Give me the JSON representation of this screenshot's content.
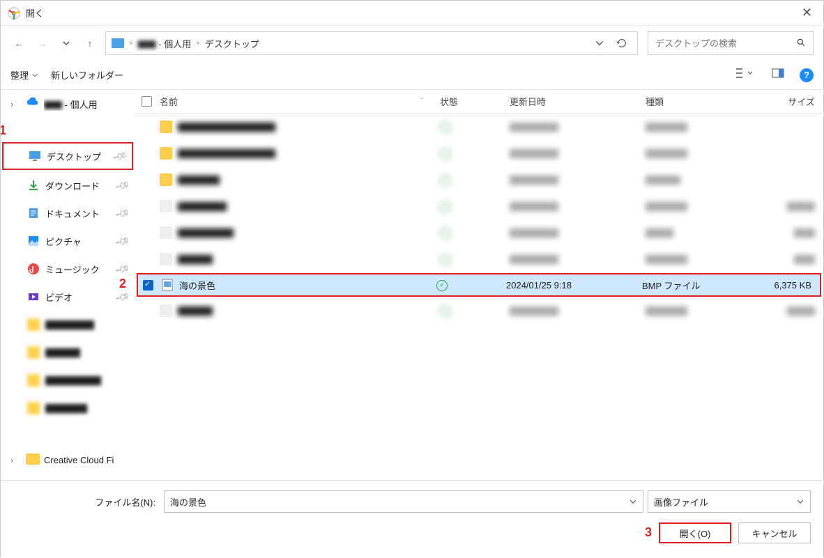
{
  "window": {
    "title": "開く"
  },
  "breadcrumbs": {
    "user_suffix": " - 個人用",
    "leaf": "デスクトップ"
  },
  "search": {
    "placeholder": "デスクトップの検索"
  },
  "toolbar": {
    "organize": "整理",
    "new_folder": "新しいフォルダー"
  },
  "columns": {
    "name": "名前",
    "state": "状態",
    "date": "更新日時",
    "type": "種類",
    "size": "サイズ"
  },
  "sidebar": {
    "onedrive_suffix": " - 個人用",
    "items": [
      {
        "label": "デスクトップ",
        "key": "desktop"
      },
      {
        "label": "ダウンロード",
        "key": "downloads"
      },
      {
        "label": "ドキュメント",
        "key": "documents"
      },
      {
        "label": "ピクチャ",
        "key": "pictures"
      },
      {
        "label": "ミュージック",
        "key": "music"
      },
      {
        "label": "ビデオ",
        "key": "videos"
      }
    ],
    "creative_cloud": "Creative Cloud Fi"
  },
  "file": {
    "name": "海の景色",
    "date": "2024/01/25 9:18",
    "type": "BMP ファイル",
    "size": "6,375 KB"
  },
  "footer": {
    "filename_label": "ファイル名(N):",
    "filename_value": "海の景色",
    "filetype": "画像ファイル",
    "open": "開く(O)",
    "cancel": "キャンセル"
  },
  "annotations": {
    "a1": "1",
    "a2": "2",
    "a3": "3"
  }
}
